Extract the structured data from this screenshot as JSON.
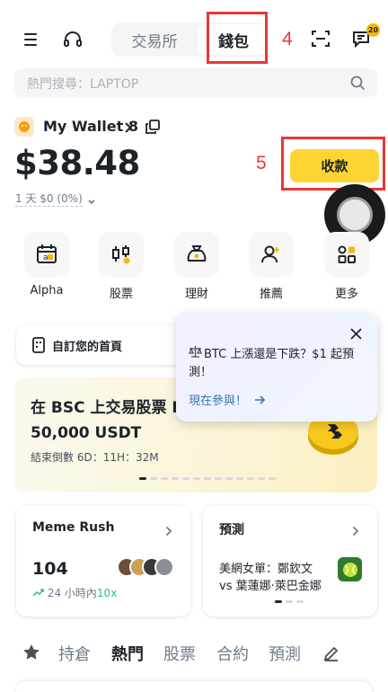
{
  "header": {
    "tabs": [
      {
        "label": "交易所"
      },
      {
        "label": "錢包"
      }
    ],
    "annotation_4": "4",
    "notification_badge": "20"
  },
  "search": {
    "placeholder": "熱門搜尋：LAPTOP"
  },
  "wallet": {
    "name": "My Wallet 8",
    "balance": "$38.48",
    "pnl_period": "1 天",
    "pnl_value": "$0 (0%)",
    "receive_label": "收款",
    "annotation_5": "5"
  },
  "quick_actions": [
    {
      "label": "Alpha",
      "icon": "alpha-calendar-icon"
    },
    {
      "label": "股票",
      "icon": "stocks-icon"
    },
    {
      "label": "理財",
      "icon": "finance-bag-icon"
    },
    {
      "label": "推薦",
      "icon": "referral-icon"
    },
    {
      "label": "更多",
      "icon": "more-grid-icon"
    }
  ],
  "customize_home": {
    "label": "自訂您的首頁"
  },
  "banner": {
    "title": "在 BSC 上交易股票 N 高 50,000 USDT",
    "countdown": "結束倒數 6D：11H：32M"
  },
  "popup": {
    "text": "BTC 上漲還是下跌？$1 起預測！",
    "link": "現在參與！"
  },
  "meme_card": {
    "title": "Meme Rush",
    "count": "104",
    "sub_prefix": "24 小時內",
    "sub_value": "10x"
  },
  "predict_card": {
    "title": "預測",
    "line1": "美網女單：鄭欽文",
    "line2": "vs 葉蓮娜·萊巴金娜"
  },
  "bottom_tabs": [
    {
      "label": "持倉"
    },
    {
      "label": "熱門"
    },
    {
      "label": "股票"
    },
    {
      "label": "合約"
    },
    {
      "label": "預測"
    }
  ],
  "colors": {
    "accent": "#FCD535",
    "annotation": "#E53935",
    "link": "#3375BB",
    "positive": "#2EBD85"
  }
}
